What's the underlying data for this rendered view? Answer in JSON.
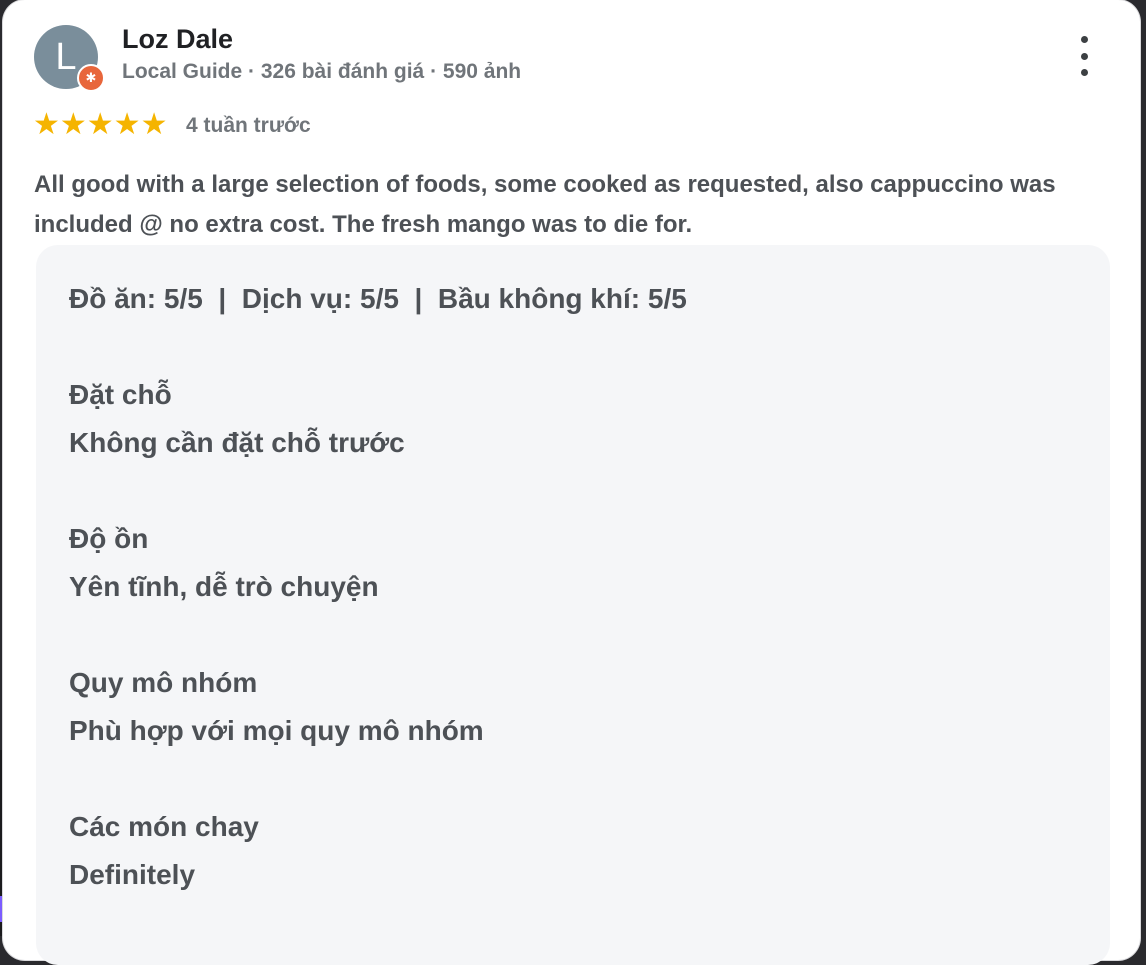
{
  "reviewer": {
    "initial": "L",
    "name": "Loz Dale",
    "meta": "Local Guide · 326 bài đánh giá · 590 ảnh",
    "badge_icon": "✱"
  },
  "rating": {
    "stars": "★★★★★",
    "value": 5,
    "max": 5,
    "time": "4 tuần trước"
  },
  "review_text": "All good with a large selection of foods, some cooked as requested, also cappuccino was included @ no extra cost. The fresh mango was to die for.",
  "attributes": {
    "scores": "Đồ ăn: 5/5  |  Dịch vụ: 5/5  |  Bầu không khí: 5/5",
    "reservation_label": "Đặt chỗ",
    "reservation_value": "Không cần đặt chỗ trước",
    "noise_label": "Độ ồn",
    "noise_value": "Yên tĩnh, dễ trò chuyện",
    "group_label": "Quy mô nhóm",
    "group_value": "Phù hợp với mọi quy mô nhóm",
    "veg_label": "Các món chay",
    "veg_value": "Definitely"
  },
  "colors": {
    "star": "#f5b400",
    "avatar": "#7a8e9b",
    "badge": "#e8663b",
    "panel": "#f5f6f8",
    "text": "#4d5156"
  }
}
